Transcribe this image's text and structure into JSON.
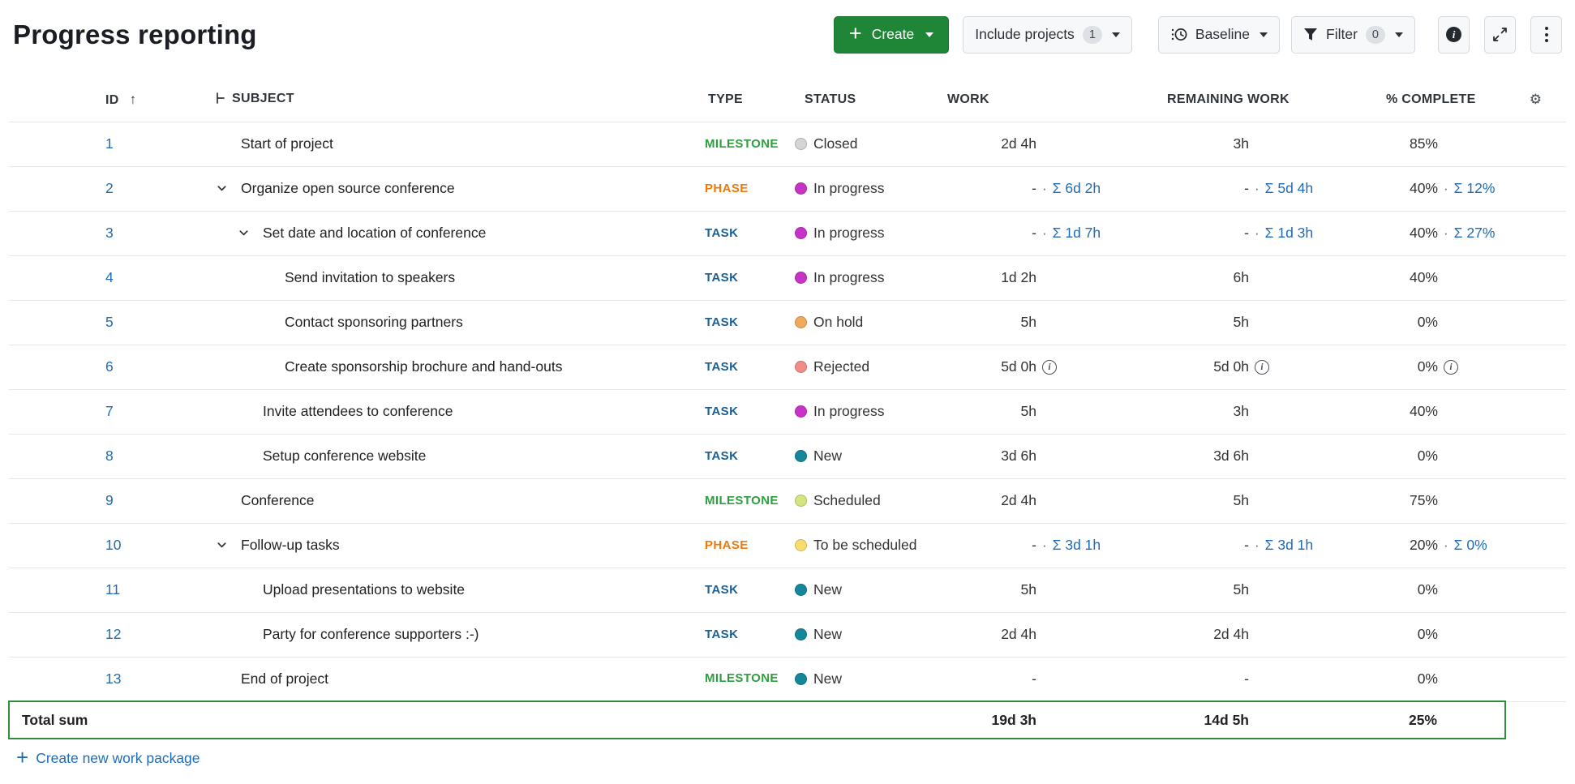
{
  "page": {
    "title": "Progress reporting"
  },
  "toolbar": {
    "create_label": "Create",
    "include_projects_label": "Include projects",
    "include_projects_badge": "1",
    "baseline_label": "Baseline",
    "filter_label": "Filter",
    "filter_badge": "0"
  },
  "icons": {
    "sort_asc": "↑",
    "gear": "⚙",
    "info_letter": "i",
    "sum_separator": "·"
  },
  "colors": {
    "create_button": "#1f8537",
    "link": "#1f6cb5",
    "sum_border": "#318c3c",
    "type": {
      "MILESTONE": "#2e9e3e",
      "PHASE": "#ee7a0d",
      "TASK": "#1a5f94"
    },
    "status": {
      "Closed": "#d5d5d5",
      "In progress": "#c733c7",
      "On hold": "#f0a95d",
      "Rejected": "#f28c88",
      "New": "#15879b",
      "Scheduled": "#d4e580",
      "To be scheduled": "#f8dd6e"
    }
  },
  "table": {
    "columns": {
      "id": "ID",
      "subject": "SUBJECT",
      "type": "TYPE",
      "status": "STATUS",
      "work": "WORK",
      "remaining_work": "REMAINING WORK",
      "percent_complete": "% COMPLETE"
    },
    "rows": [
      {
        "id": "1",
        "level": 0,
        "chevron": false,
        "subject": "Start of project",
        "type": "MILESTONE",
        "status": "Closed",
        "work": "2d 4h",
        "rw": "3h",
        "pc": "85%"
      },
      {
        "id": "2",
        "level": 0,
        "chevron": true,
        "subject": "Organize open source conference",
        "type": "PHASE",
        "status": "In progress",
        "work": "-",
        "work_sum": "Σ 6d 2h",
        "rw": "-",
        "rw_sum": "Σ 5d 4h",
        "pc": "40%",
        "pc_sum": "Σ 12%"
      },
      {
        "id": "3",
        "level": 1,
        "chevron": true,
        "subject": "Set date and location of conference",
        "type": "TASK",
        "status": "In progress",
        "work": "-",
        "work_sum": "Σ 1d 7h",
        "rw": "-",
        "rw_sum": "Σ 1d 3h",
        "pc": "40%",
        "pc_sum": "Σ 27%"
      },
      {
        "id": "4",
        "level": 2,
        "chevron": false,
        "subject": "Send invitation to speakers",
        "type": "TASK",
        "status": "In progress",
        "work": "1d 2h",
        "rw": "6h",
        "pc": "40%"
      },
      {
        "id": "5",
        "level": 2,
        "chevron": false,
        "subject": "Contact sponsoring partners",
        "type": "TASK",
        "status": "On hold",
        "work": "5h",
        "rw": "5h",
        "pc": "0%"
      },
      {
        "id": "6",
        "level": 2,
        "chevron": false,
        "subject": "Create sponsorship brochure and hand-outs",
        "type": "TASK",
        "status": "Rejected",
        "work": "5d 0h",
        "work_info": true,
        "rw": "5d 0h",
        "rw_info": true,
        "pc": "0%",
        "pc_info": true
      },
      {
        "id": "7",
        "level": 1,
        "chevron": false,
        "subject": "Invite attendees to conference",
        "type": "TASK",
        "status": "In progress",
        "work": "5h",
        "rw": "3h",
        "pc": "40%"
      },
      {
        "id": "8",
        "level": 1,
        "chevron": false,
        "subject": "Setup conference website",
        "type": "TASK",
        "status": "New",
        "work": "3d 6h",
        "rw": "3d 6h",
        "pc": "0%"
      },
      {
        "id": "9",
        "level": 0,
        "chevron": false,
        "subject": "Conference",
        "type": "MILESTONE",
        "status": "Scheduled",
        "work": "2d 4h",
        "rw": "5h",
        "pc": "75%"
      },
      {
        "id": "10",
        "level": 0,
        "chevron": true,
        "subject": "Follow-up tasks",
        "type": "PHASE",
        "status": "To be scheduled",
        "work": "-",
        "work_sum": "Σ 3d 1h",
        "rw": "-",
        "rw_sum": "Σ 3d 1h",
        "pc": "20%",
        "pc_sum": "Σ 0%"
      },
      {
        "id": "11",
        "level": 1,
        "chevron": false,
        "subject": "Upload presentations to website",
        "type": "TASK",
        "status": "New",
        "work": "5h",
        "rw": "5h",
        "pc": "0%"
      },
      {
        "id": "12",
        "level": 1,
        "chevron": false,
        "subject": "Party for conference supporters :-)",
        "type": "TASK",
        "status": "New",
        "work": "2d 4h",
        "rw": "2d 4h",
        "pc": "0%"
      },
      {
        "id": "13",
        "level": 0,
        "chevron": false,
        "subject": "End of project",
        "type": "MILESTONE",
        "status": "New",
        "work": "-",
        "rw": "-",
        "pc": "0%"
      }
    ],
    "sum_row": {
      "label": "Total sum",
      "work": "19d 3h",
      "rw": "14d 5h",
      "pc": "25%"
    },
    "footer_link": "Create new work package"
  }
}
